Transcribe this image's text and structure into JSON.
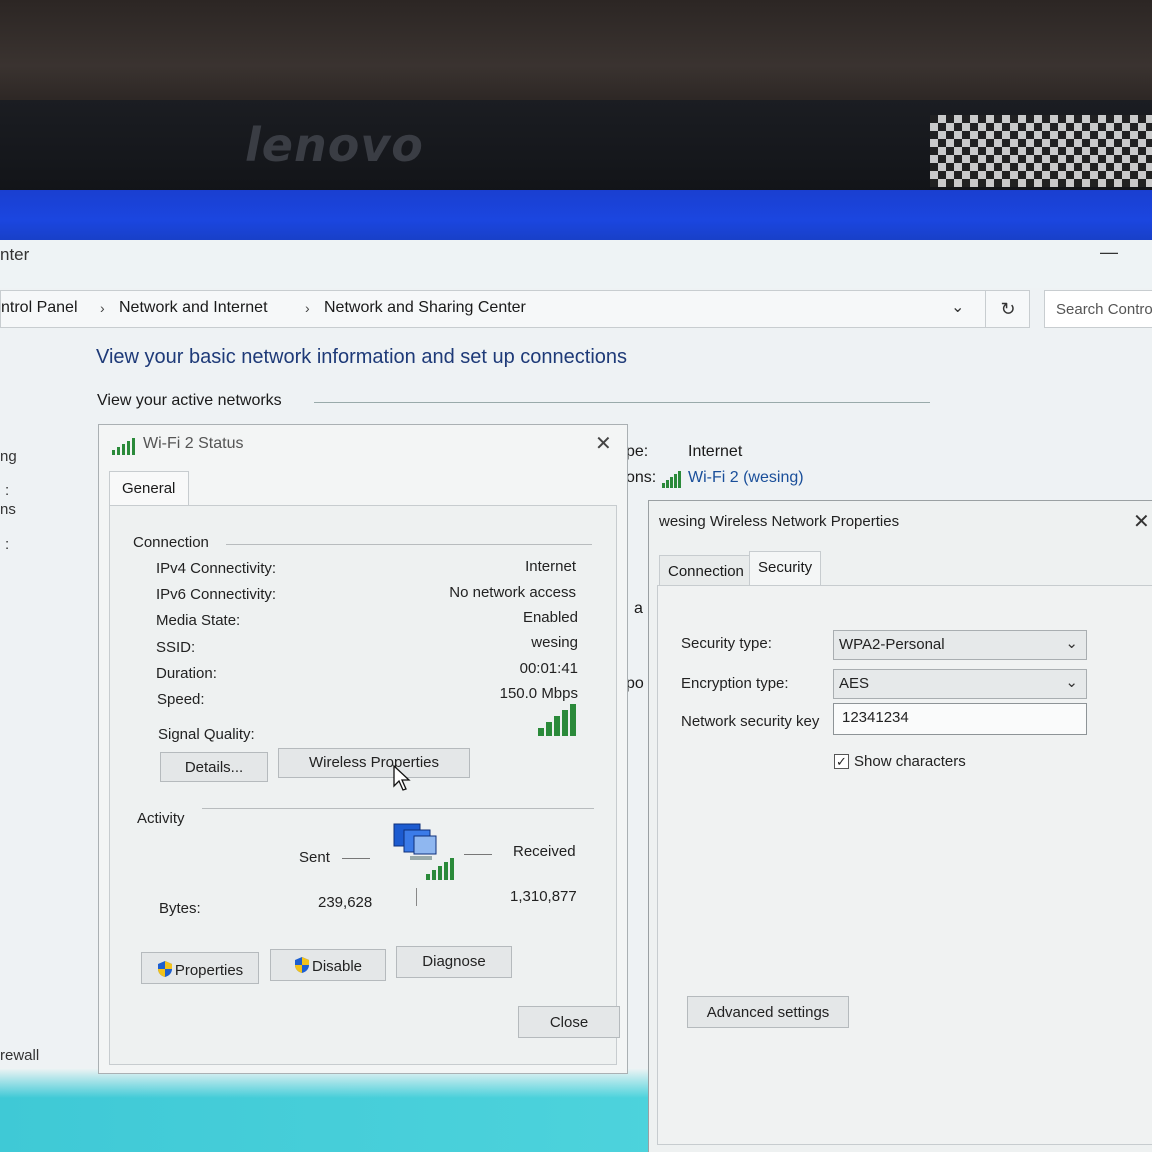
{
  "brand": "lenovo",
  "window": {
    "title": "nter",
    "minimize": "—"
  },
  "address": {
    "crumbs": [
      "ntrol Panel",
      "Network and Internet",
      "Network and Sharing Center"
    ],
    "separator": "›",
    "dropdown_glyph": "⌄",
    "refresh_glyph": "↻",
    "search_placeholder": "Search Contro"
  },
  "main": {
    "heading": "View your basic network information and set up connections",
    "active_networks_label": "View your active networks",
    "left_fragments": [
      "ng",
      ":",
      "ns",
      ":",
      "rewall"
    ],
    "access_type_frag": "pe:",
    "access_type_value": "Internet",
    "connections_frag": "ons:",
    "connection_link": "Wi-Fi 2 (wesing)",
    "frag_a": "a",
    "frag_po": "po"
  },
  "wifi_status": {
    "title": "Wi-Fi 2 Status",
    "close_glyph": "✕",
    "tab": "General",
    "connection_group": "Connection",
    "rows": [
      {
        "label": "IPv4 Connectivity:",
        "value": "Internet"
      },
      {
        "label": "IPv6 Connectivity:",
        "value": "No network access"
      },
      {
        "label": "Media State:",
        "value": "Enabled"
      },
      {
        "label": "SSID:",
        "value": "wesing"
      },
      {
        "label": "Duration:",
        "value": "00:01:41"
      },
      {
        "label": "Speed:",
        "value": "150.0 Mbps"
      }
    ],
    "signal_label": "Signal Quality:",
    "signal_bars": 5,
    "details_button": "Details...",
    "wireless_properties_button": "Wireless Properties",
    "activity_group": "Activity",
    "sent_label": "Sent",
    "received_label": "Received",
    "bytes_label": "Bytes:",
    "bytes_sent": "239,628",
    "bytes_received": "1,310,877",
    "properties_button": "Properties",
    "disable_button": "Disable",
    "diagnose_button": "Diagnose",
    "close_button": "Close"
  },
  "wireless_props": {
    "title": "wesing Wireless Network Properties",
    "close_glyph": "✕",
    "tabs": [
      "Connection",
      "Security"
    ],
    "security_type_label": "Security type:",
    "security_type_value": "WPA2-Personal",
    "encryption_type_label": "Encryption type:",
    "encryption_type_value": "AES",
    "key_label": "Network security key",
    "key_value": "12341234",
    "show_characters_label": "Show characters",
    "show_characters_checked": "✓",
    "advanced_button": "Advanced settings"
  },
  "colors": {
    "accent_blue": "#1b46e0",
    "link": "#1a4f9a",
    "signal_green": "#2a8a3a",
    "cyan": "#4dd3dc"
  }
}
